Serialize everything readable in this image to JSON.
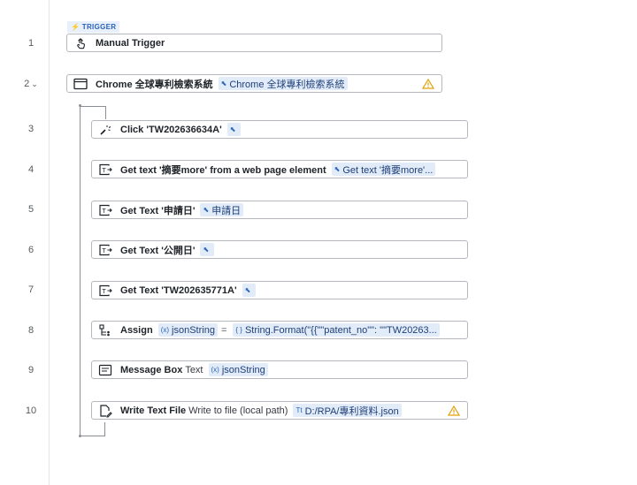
{
  "trigger_tag": "⚡ TRIGGER",
  "rows": [
    {
      "line": "1",
      "title": "Manual Trigger",
      "plain": "",
      "chips": []
    },
    {
      "line": "2",
      "chevron": "⌄",
      "title": "Chrome 全球專利檢索系統",
      "plain": "",
      "chips": [
        {
          "icon": "element-icon",
          "label": "Chrome 全球專利檢索系統"
        }
      ],
      "warning": true
    },
    {
      "line": "3",
      "title": "Click 'TW202636634A'",
      "plain": "",
      "chips": [
        {
          "icon": "element-icon",
          "label": ""
        }
      ]
    },
    {
      "line": "4",
      "title": "Get text '摘要more' from a web page element",
      "plain": "",
      "chips": [
        {
          "icon": "element-icon",
          "label": "Get text '摘要more'..."
        }
      ]
    },
    {
      "line": "5",
      "title": "Get Text '申請日'",
      "plain": "",
      "chips": [
        {
          "icon": "element-icon",
          "label": "申請日"
        }
      ]
    },
    {
      "line": "6",
      "title": "Get Text '公開日'",
      "plain": "",
      "chips": [
        {
          "icon": "element-icon",
          "label": ""
        }
      ]
    },
    {
      "line": "7",
      "title": "Get Text 'TW202635771A'",
      "plain": "",
      "chips": [
        {
          "icon": "element-icon",
          "label": ""
        }
      ]
    },
    {
      "line": "8",
      "title": "Assign",
      "plain": "",
      "chips": [
        {
          "icon": "variable-icon",
          "label": "jsonString"
        }
      ],
      "equals": "=",
      "chips2": [
        {
          "icon": "expression-icon",
          "label": "String.Format(\"{{\"\"patent_no\"\": \"\"TW20263..."
        }
      ]
    },
    {
      "line": "9",
      "title": "Message Box",
      "plain": "Text",
      "chips": [
        {
          "icon": "variable-icon",
          "label": "jsonString"
        }
      ]
    },
    {
      "line": "10",
      "title": "Write Text File",
      "plain": "Write to file (local path)",
      "chips": [
        {
          "icon": "text-icon",
          "label": "D:/RPA/專利資料.json"
        }
      ],
      "warning": true
    }
  ],
  "colors": {
    "accent": "#2a62b8",
    "chip_bg": "#e2ecf8",
    "warning": "#e3a008"
  }
}
